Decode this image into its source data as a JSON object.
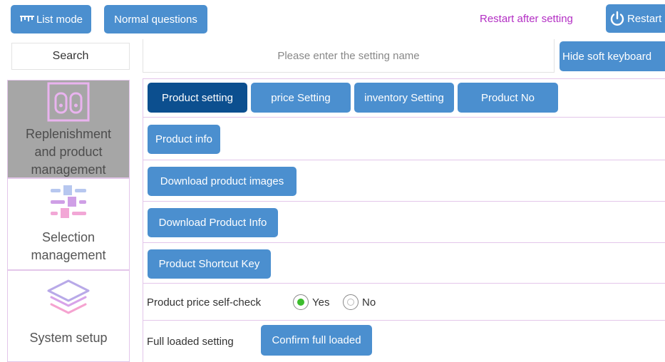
{
  "toolbar": {
    "list_mode": "List mode",
    "normal_questions": "Normal questions",
    "restart_note": "Restart after setting",
    "restart": "Restart"
  },
  "search": {
    "button": "Search",
    "placeholder": "Please enter the setting name",
    "hide_keyboard": "Hide soft keyboard"
  },
  "sidebar": {
    "items": [
      {
        "label": "Replenishment and product management",
        "icon": "vending-machine-icon",
        "active": true
      },
      {
        "label": "Selection management",
        "icon": "sliders-icon",
        "active": false
      },
      {
        "label": "System setup",
        "icon": "layers-icon",
        "active": false
      }
    ]
  },
  "tabs": [
    {
      "label": "Product setting",
      "active": true
    },
    {
      "label": "price Setting",
      "active": false
    },
    {
      "label": "inventory Setting",
      "active": false
    },
    {
      "label": "Product No",
      "active": false
    }
  ],
  "actions": {
    "product_info": "Product info",
    "download_images": "Download product images",
    "download_info": "Download Product Info",
    "shortcut_key": "Product Shortcut Key"
  },
  "price_check": {
    "label": "Product price self-check",
    "yes": "Yes",
    "no": "No",
    "selected": "Yes"
  },
  "full_loaded": {
    "label": "Full loaded setting",
    "button": "Confirm full loaded"
  },
  "colors": {
    "button": "#4b8fcf",
    "button_active": "#0c4f8f",
    "restart_note": "#b32fc4",
    "border": "#e3c6ea",
    "sidebar_active": "#a6a6a6",
    "radio_on": "#3cbc2d"
  }
}
